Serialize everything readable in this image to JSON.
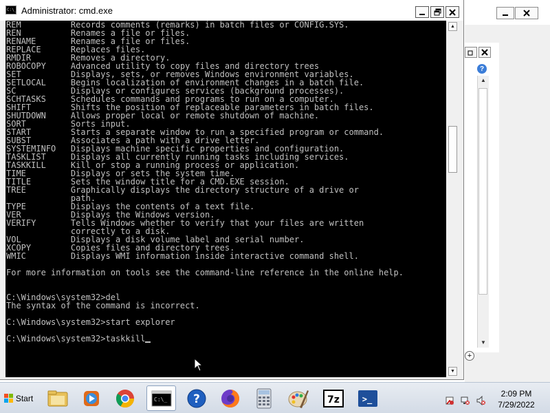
{
  "window": {
    "title": "Administrator: cmd.exe",
    "icon_label": "C:\\_",
    "minimize_icon": "minimize-icon",
    "maximize_icon": "restore-icon",
    "close_icon": "close-icon"
  },
  "console": {
    "lines": [
      "REM          Records comments (remarks) in batch files or CONFIG.SYS.",
      "REN          Renames a file or files.",
      "RENAME       Renames a file or files.",
      "REPLACE      Replaces files.",
      "RMDIR        Removes a directory.",
      "ROBOCOPY     Advanced utility to copy files and directory trees",
      "SET          Displays, sets, or removes Windows environment variables.",
      "SETLOCAL     Begins localization of environment changes in a batch file.",
      "SC           Displays or configures services (background processes).",
      "SCHTASKS     Schedules commands and programs to run on a computer.",
      "SHIFT        Shifts the position of replaceable parameters in batch files.",
      "SHUTDOWN     Allows proper local or remote shutdown of machine.",
      "SORT         Sorts input.",
      "START        Starts a separate window to run a specified program or command.",
      "SUBST        Associates a path with a drive letter.",
      "SYSTEMINFO   Displays machine specific properties and configuration.",
      "TASKLIST     Displays all currently running tasks including services.",
      "TASKKILL     Kill or stop a running process or application.",
      "TIME         Displays or sets the system time.",
      "TITLE        Sets the window title for a CMD.EXE session.",
      "TREE         Graphically displays the directory structure of a drive or",
      "             path.",
      "TYPE         Displays the contents of a text file.",
      "VER          Displays the Windows version.",
      "VERIFY       Tells Windows whether to verify that your files are written",
      "             correctly to a disk.",
      "VOL          Displays a disk volume label and serial number.",
      "XCOPY        Copies files and directory trees.",
      "WMIC         Displays WMI information inside interactive command shell.",
      "",
      "For more information on tools see the command-line reference in the online help.",
      "",
      "",
      "C:\\Windows\\system32>del",
      "The syntax of the command is incorrect.",
      "",
      "C:\\Windows\\system32>start explorer",
      "",
      "C:\\Windows\\system32>taskkill"
    ],
    "text_color": "#c0c0c0",
    "background": "#000000"
  },
  "background_window": {
    "minimize_icon": "minimize-icon",
    "close_icon": "close-icon",
    "dialog_close_icon": "close-icon",
    "help_icon": "help-icon",
    "help_glyph": "?",
    "zoom_glyph": "+"
  },
  "taskbar": {
    "start_label": "Start",
    "pinned": [
      {
        "name": "explorer",
        "icon": "folder-icon"
      },
      {
        "name": "media-player",
        "icon": "media-player-icon"
      },
      {
        "name": "chrome",
        "icon": "chrome-icon"
      },
      {
        "name": "cmd",
        "icon": "cmd-icon",
        "active": true,
        "glyph": "C:\\_"
      },
      {
        "name": "help",
        "icon": "help-icon",
        "glyph": "?"
      },
      {
        "name": "firefox",
        "icon": "firefox-icon"
      },
      {
        "name": "calculator",
        "icon": "calculator-icon"
      },
      {
        "name": "paint",
        "icon": "paint-icon"
      },
      {
        "name": "7zip",
        "icon": "7zip-icon",
        "glyph": "7z"
      },
      {
        "name": "powershell",
        "icon": "powershell-icon",
        "glyph": ">_"
      }
    ],
    "tray_icons": [
      "action-center-icon",
      "network-icon",
      "volume-icon"
    ],
    "clock_time": "2:09 PM",
    "clock_date": "7/29/2022"
  },
  "colors": {
    "console_bg": "#000000",
    "console_fg": "#c0c0c0",
    "taskbar_bg": "#dde4ee",
    "titlebar_bg": "#ffffff"
  }
}
